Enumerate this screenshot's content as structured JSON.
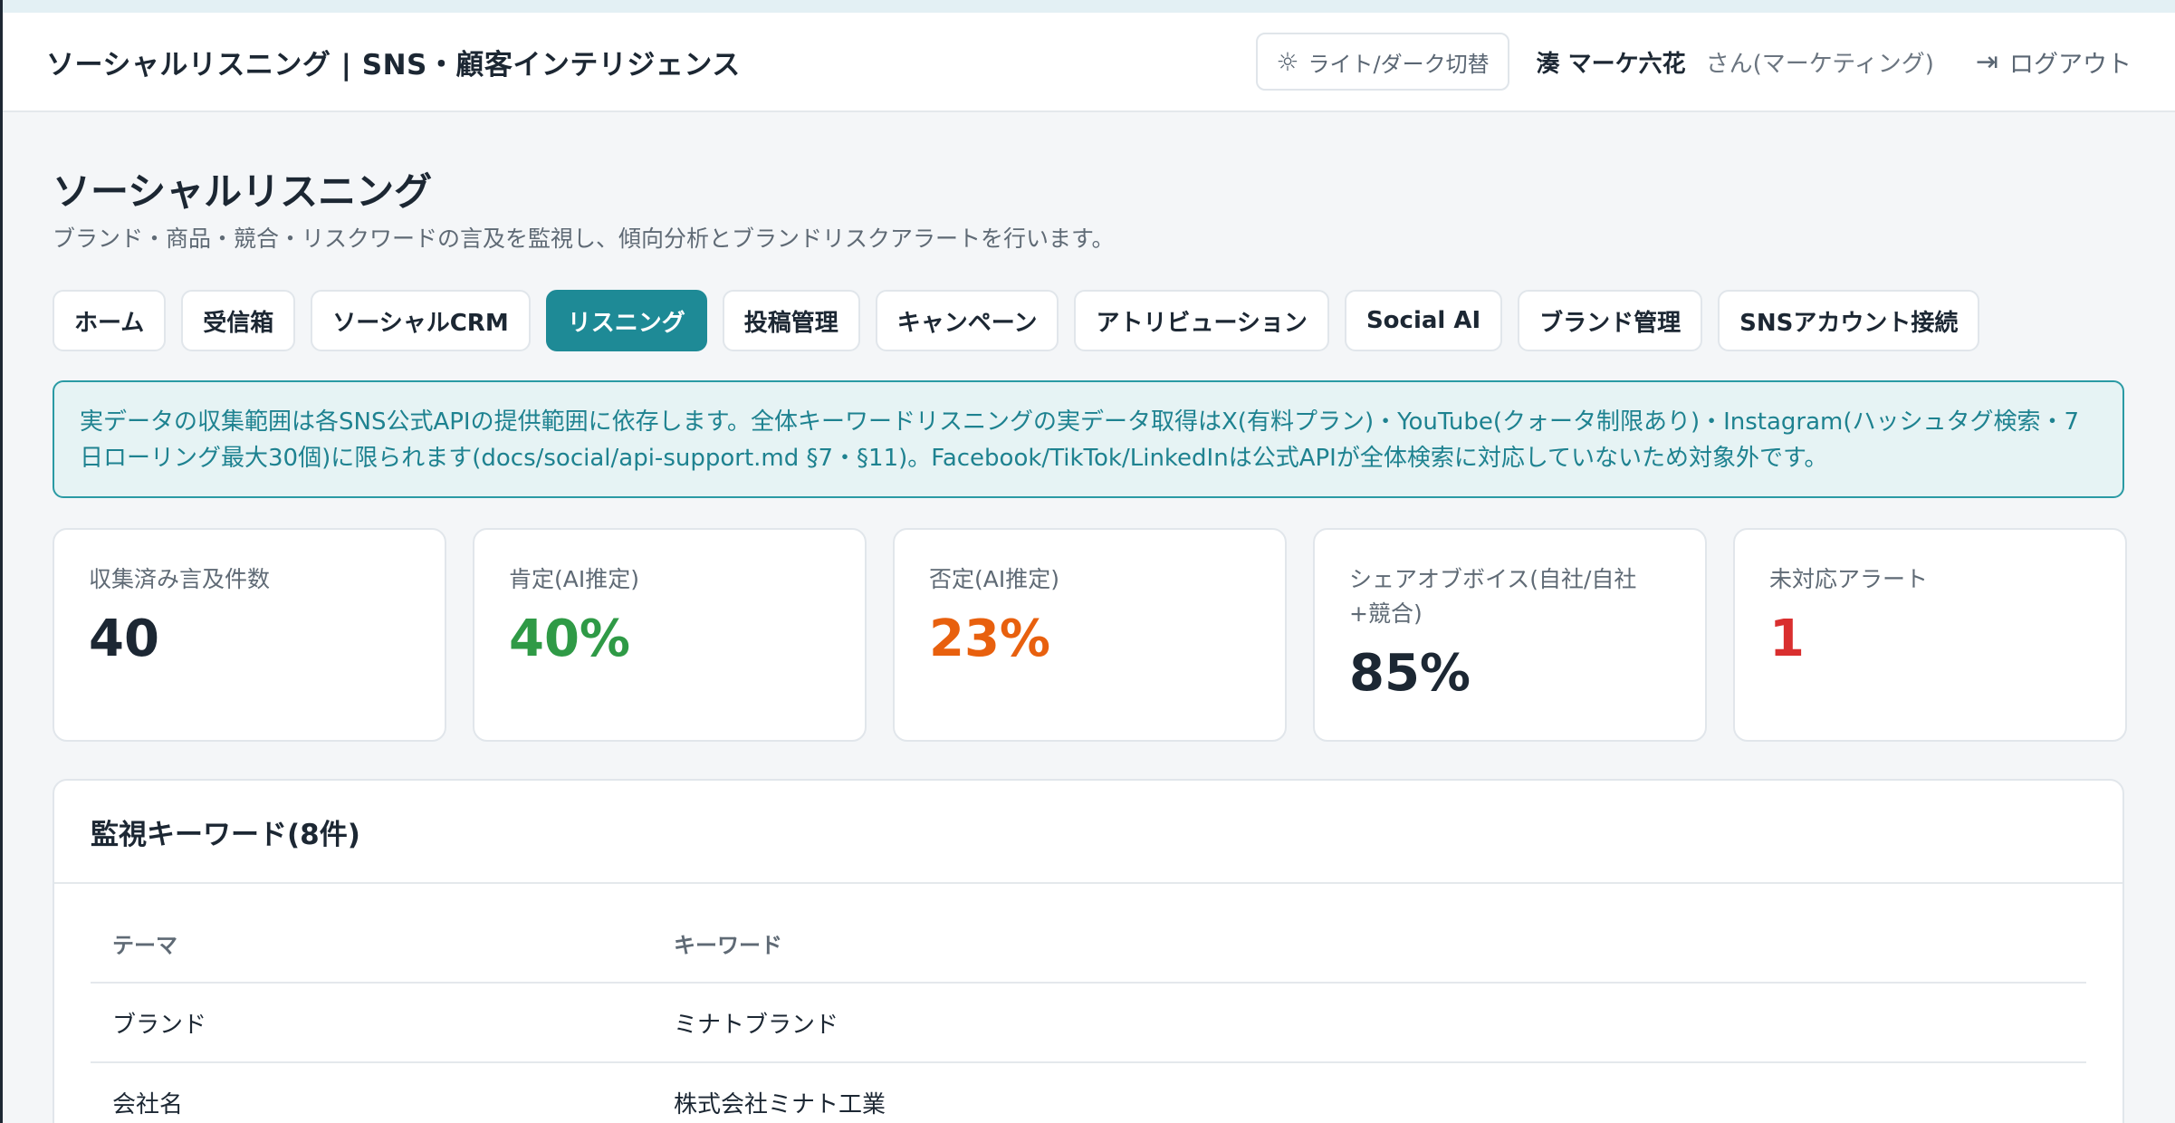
{
  "header": {
    "title": "ソーシャルリスニング | SNS・顧客インテリジェンス",
    "theme_toggle": "ライト/ダーク切替",
    "user_name": "湊 マーケ六花",
    "user_role": "さん(マーケティング)",
    "logout": "ログアウト"
  },
  "page": {
    "title": "ソーシャルリスニング",
    "subtitle": "ブランド・商品・競合・リスクワードの言及を監視し、傾向分析とブランドリスクアラートを行います。"
  },
  "tabs": [
    {
      "label": "ホーム"
    },
    {
      "label": "受信箱"
    },
    {
      "label": "ソーシャルCRM"
    },
    {
      "label": "リスニング"
    },
    {
      "label": "投稿管理"
    },
    {
      "label": "キャンペーン"
    },
    {
      "label": "アトリビューション"
    },
    {
      "label": "Social AI"
    },
    {
      "label": "ブランド管理"
    },
    {
      "label": "SNSアカウント接続"
    }
  ],
  "notice": "実データの収集範囲は各SNS公式APIの提供範囲に依存します。全体キーワードリスニングの実データ取得はX(有料プラン)・YouTube(クォータ制限あり)・Instagram(ハッシュタグ検索・7日ローリング最大30個)に限られます(docs/social/api-support.md §7・§11)。Facebook/TikTok/LinkedInは公式APIが全体検索に対応していないため対象外です。",
  "kpis": [
    {
      "label": "収集済み言及件数",
      "value": "40",
      "color": "#1c2733"
    },
    {
      "label": "肯定(AI推定)",
      "value": "40%",
      "color": "#2f9a46"
    },
    {
      "label": "否定(AI推定)",
      "value": "23%",
      "color": "#e8600e"
    },
    {
      "label": "シェアオブボイス(自社/自社+競合)",
      "value": "85%",
      "color": "#1c2733"
    },
    {
      "label": "未対応アラート",
      "value": "1",
      "color": "#d92f2f"
    }
  ],
  "keywords": {
    "title": "監視キーワード(8件)",
    "columns": [
      "テーマ",
      "キーワード"
    ],
    "rows": [
      [
        "ブランド",
        "ミナトブランド"
      ],
      [
        "会社名",
        "株式会社ミナト工業"
      ]
    ]
  }
}
